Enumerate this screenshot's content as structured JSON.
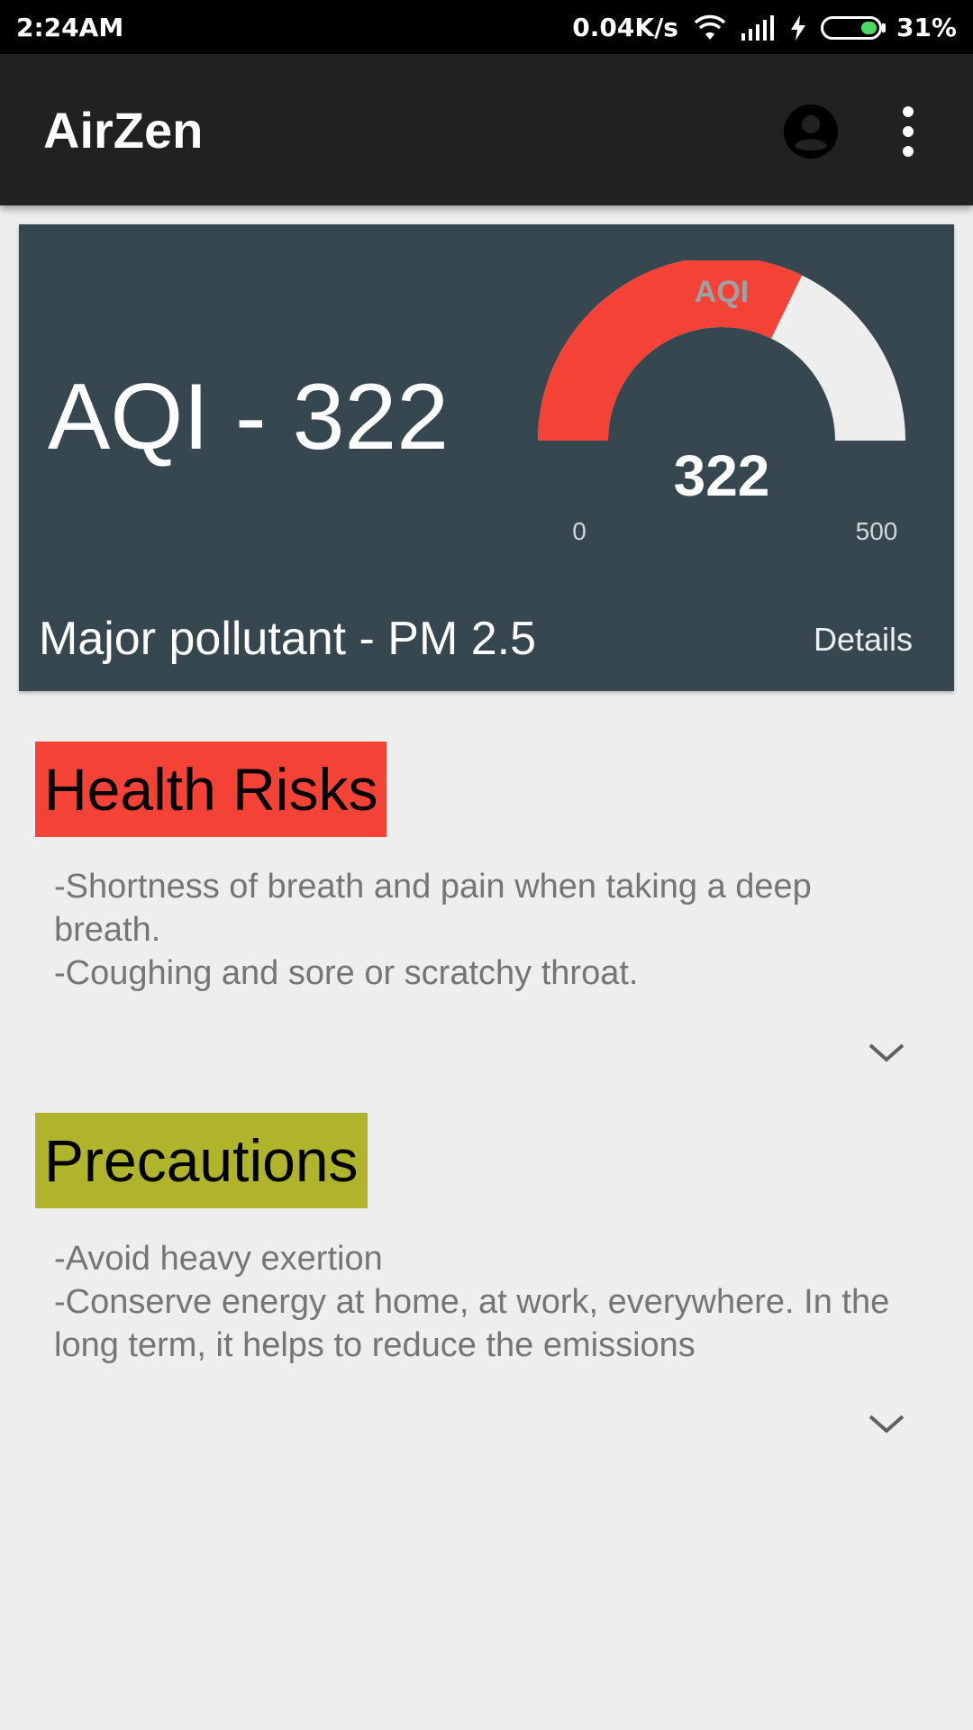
{
  "status_bar": {
    "time": "2:24AM",
    "network_speed": "0.04K/s",
    "battery_percent_label": "31%",
    "battery_level": 0.31,
    "icons": [
      "wifi-icon",
      "signal-icon",
      "charging-icon",
      "battery-icon"
    ]
  },
  "app_bar": {
    "title": "AirZen",
    "icons": [
      "account-circle-icon",
      "more-vert-icon"
    ]
  },
  "aqi_card": {
    "headline": "AQI - 322",
    "gauge": {
      "title": "AQI",
      "value": 322,
      "value_label": "322",
      "min": 0,
      "max": 500,
      "min_label": "0",
      "max_label": "500",
      "fill_color": "#f44336",
      "track_color": "#eeeeee"
    },
    "major_pollutant": "Major pollutant - PM 2.5",
    "details_label": "Details",
    "background_color": "#37474f"
  },
  "sections": {
    "health": {
      "title": "Health Risks",
      "color": "#f44336",
      "lines": [
        "-Shortness of breath and pain when taking a deep breath.",
        "-Coughing and sore or scratchy throat."
      ]
    },
    "precautions": {
      "title": "Precautions",
      "color": "#afb42b",
      "lines": [
        "-Avoid heavy exertion",
        "-Conserve energy at home, at work, everywhere. In the long term, it helps to reduce the emissions"
      ]
    }
  }
}
